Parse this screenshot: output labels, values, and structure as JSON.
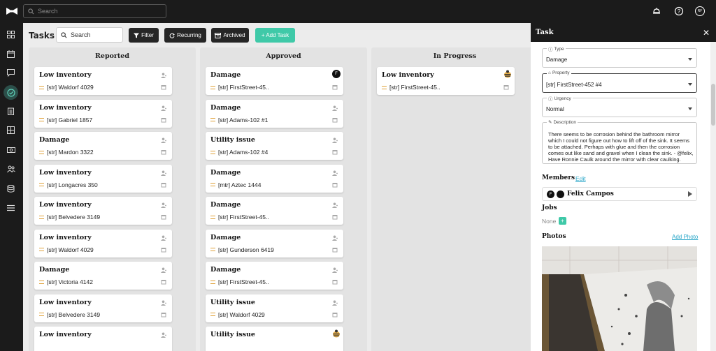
{
  "topbar": {
    "search_placeholder": "Search",
    "user_initials": "RF",
    "icons": [
      "logo-bowtie-icon",
      "bell-icon",
      "help-icon",
      "user-avatar"
    ]
  },
  "sidebar": {
    "items": [
      {
        "name": "dashboard",
        "icon": "grid-icon"
      },
      {
        "name": "calendar",
        "icon": "calendar-icon"
      },
      {
        "name": "messages",
        "icon": "chat-icon"
      },
      {
        "name": "tasks",
        "icon": "check-circle-icon",
        "active": true
      },
      {
        "name": "reports",
        "icon": "clipboard-icon"
      },
      {
        "name": "properties",
        "icon": "building-icon"
      },
      {
        "name": "payments",
        "icon": "money-icon"
      },
      {
        "name": "people",
        "icon": "people-icon"
      },
      {
        "name": "storage",
        "icon": "database-icon"
      },
      {
        "name": "menu",
        "icon": "menu-icon"
      }
    ]
  },
  "toolbar": {
    "title": "Tasks",
    "search_placeholder": "Search",
    "filter_label": "Filter",
    "recurring_label": "Recurring",
    "archived_label": "Archived",
    "add_task_label": "+ Add Task"
  },
  "columns": [
    {
      "title": "Reported",
      "cards": [
        {
          "title": "Low inventory",
          "property": "[str] Waldorf 4029"
        },
        {
          "title": "Low inventory",
          "property": "[str] Gabriel 1857"
        },
        {
          "title": "Damage",
          "property": "[str] Mardon 3322"
        },
        {
          "title": "Low inventory",
          "property": "[str] Longacres 350"
        },
        {
          "title": "Low inventory",
          "property": "[str] Belvedere 3149"
        },
        {
          "title": "Low inventory",
          "property": "[str] Waldorf 4029"
        },
        {
          "title": "Damage",
          "property": "[str] Victoria 4142"
        },
        {
          "title": "Low inventory",
          "property": "[str] Belvedere 3149"
        },
        {
          "title": "Low inventory",
          "property": ""
        }
      ]
    },
    {
      "title": "Approved",
      "cards": [
        {
          "title": "Damage",
          "property": "[str] FirstStreet-45..",
          "assignee": "F"
        },
        {
          "title": "Damage",
          "property": "[str] Adams-102 #1"
        },
        {
          "title": "Utility issue",
          "property": "[str] Adams-102 #4"
        },
        {
          "title": "Damage",
          "property": "[mtr] Aztec 1444"
        },
        {
          "title": "Damage",
          "property": "[str] FirstStreet-45.."
        },
        {
          "title": "Damage",
          "property": "[str] Gunderson 6419"
        },
        {
          "title": "Damage",
          "property": "[str] FirstStreet-45.."
        },
        {
          "title": "Utility issue",
          "property": "[str] Waldorf 4029"
        },
        {
          "title": "Utility issue",
          "property": "",
          "assignee_icon": "bee-avatar"
        }
      ]
    },
    {
      "title": "In Progress",
      "cards": [
        {
          "title": "Low inventory",
          "property": "[str] FirstStreet-45..",
          "assignee_icon": "bee-avatar"
        }
      ]
    }
  ],
  "panel": {
    "title": "Task",
    "type": {
      "label": "Type",
      "value": "Damage"
    },
    "property": {
      "label": "Property",
      "value": "[str] FirstStreet-452 #4"
    },
    "urgency": {
      "label": "Urgency",
      "value": "Normal"
    },
    "description": {
      "label": "Description",
      "value": "There seems to be corrosion behind the bathroom mirror which I could not figure out how to lift off of the sink. It seems to be attached. Perhaps with glue and then the corrosion comes out like sand and gravel when I clean the sink. - @felix, Have Ronnie Caulk around the mirror with clear caulking."
    },
    "members": {
      "title": "Members",
      "edit_label": "Edit",
      "member_initial": "F",
      "member_name": "Felix Campos"
    },
    "jobs": {
      "title": "Jobs",
      "none_label": "None"
    },
    "photos": {
      "title": "Photos",
      "add_label": "Add Photo"
    }
  },
  "colors": {
    "accent": "#3fc9a8",
    "dark": "#1b1b1b",
    "priority": "#e0a23a",
    "link": "#2aa7c9"
  }
}
